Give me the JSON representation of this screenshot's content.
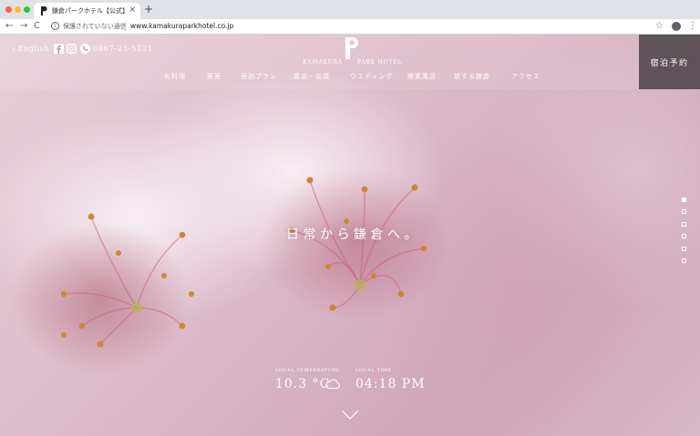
{
  "browser": {
    "tab_title": "鎌倉パークホテル【公式】 | KA",
    "tab_close": "×",
    "new_tab": "+",
    "security_label": "保護されていない通信",
    "url": "www.kamakuraparkhotel.co.jp",
    "info_glyph": "i",
    "back_glyph": "←",
    "forward_glyph": "→",
    "reload_glyph": "C",
    "star_glyph": "☆",
    "menu_glyph": "⋮"
  },
  "header": {
    "lang_link": "› English",
    "phone": "0467-25-5121",
    "logo": {
      "left": "KAMAKURA",
      "right": "PARK HOTEL"
    },
    "reserve_button": "宿泊予約"
  },
  "nav": {
    "items": [
      "お料理",
      "客室",
      "宿泊プラン",
      "宴会・会議",
      "ウエディング",
      "酵素風呂",
      "旅する鎌倉",
      "アクセス"
    ]
  },
  "hero": {
    "catch": "日常から鎌倉へ。",
    "slides": 6,
    "active_slide": 0
  },
  "weather": {
    "temp_label": "LOCAL TEMPERATURE",
    "temp_value": "10.3 °C",
    "time_label": "LOCAL TIME",
    "time_value": "04:18 PM"
  },
  "icons": {
    "favicon": "p-logo-icon",
    "facebook": "facebook-icon",
    "instagram": "instagram-icon",
    "tel": "phone-icon",
    "weather": "cloud-icon",
    "scroll": "chevron-down-icon"
  },
  "colors": {
    "reserve_bg": "#5d5358",
    "text_on_hero": "#ffffff"
  }
}
